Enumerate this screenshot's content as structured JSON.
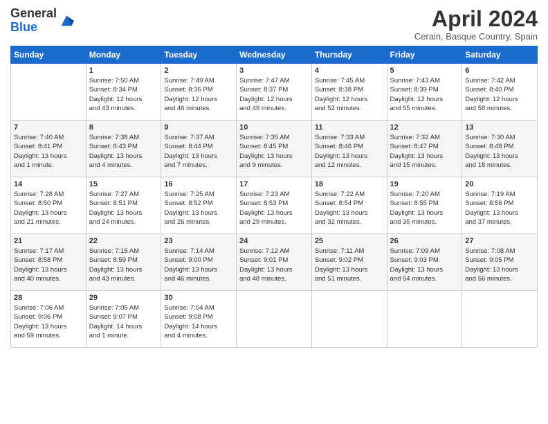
{
  "header": {
    "logo_general": "General",
    "logo_blue": "Blue",
    "title": "April 2024",
    "location": "Cerain, Basque Country, Spain"
  },
  "days_of_week": [
    "Sunday",
    "Monday",
    "Tuesday",
    "Wednesday",
    "Thursday",
    "Friday",
    "Saturday"
  ],
  "weeks": [
    [
      {
        "day": "",
        "info": ""
      },
      {
        "day": "1",
        "info": "Sunrise: 7:50 AM\nSunset: 8:34 PM\nDaylight: 12 hours\nand 43 minutes."
      },
      {
        "day": "2",
        "info": "Sunrise: 7:49 AM\nSunset: 8:36 PM\nDaylight: 12 hours\nand 46 minutes."
      },
      {
        "day": "3",
        "info": "Sunrise: 7:47 AM\nSunset: 8:37 PM\nDaylight: 12 hours\nand 49 minutes."
      },
      {
        "day": "4",
        "info": "Sunrise: 7:45 AM\nSunset: 8:38 PM\nDaylight: 12 hours\nand 52 minutes."
      },
      {
        "day": "5",
        "info": "Sunrise: 7:43 AM\nSunset: 8:39 PM\nDaylight: 12 hours\nand 55 minutes."
      },
      {
        "day": "6",
        "info": "Sunrise: 7:42 AM\nSunset: 8:40 PM\nDaylight: 12 hours\nand 58 minutes."
      }
    ],
    [
      {
        "day": "7",
        "info": "Sunrise: 7:40 AM\nSunset: 8:41 PM\nDaylight: 13 hours\nand 1 minute."
      },
      {
        "day": "8",
        "info": "Sunrise: 7:38 AM\nSunset: 8:43 PM\nDaylight: 13 hours\nand 4 minutes."
      },
      {
        "day": "9",
        "info": "Sunrise: 7:37 AM\nSunset: 8:44 PM\nDaylight: 13 hours\nand 7 minutes."
      },
      {
        "day": "10",
        "info": "Sunrise: 7:35 AM\nSunset: 8:45 PM\nDaylight: 13 hours\nand 9 minutes."
      },
      {
        "day": "11",
        "info": "Sunrise: 7:33 AM\nSunset: 8:46 PM\nDaylight: 13 hours\nand 12 minutes."
      },
      {
        "day": "12",
        "info": "Sunrise: 7:32 AM\nSunset: 8:47 PM\nDaylight: 13 hours\nand 15 minutes."
      },
      {
        "day": "13",
        "info": "Sunrise: 7:30 AM\nSunset: 8:48 PM\nDaylight: 13 hours\nand 18 minutes."
      }
    ],
    [
      {
        "day": "14",
        "info": "Sunrise: 7:28 AM\nSunset: 8:50 PM\nDaylight: 13 hours\nand 21 minutes."
      },
      {
        "day": "15",
        "info": "Sunrise: 7:27 AM\nSunset: 8:51 PM\nDaylight: 13 hours\nand 24 minutes."
      },
      {
        "day": "16",
        "info": "Sunrise: 7:25 AM\nSunset: 8:52 PM\nDaylight: 13 hours\nand 26 minutes."
      },
      {
        "day": "17",
        "info": "Sunrise: 7:23 AM\nSunset: 8:53 PM\nDaylight: 13 hours\nand 29 minutes."
      },
      {
        "day": "18",
        "info": "Sunrise: 7:22 AM\nSunset: 8:54 PM\nDaylight: 13 hours\nand 32 minutes."
      },
      {
        "day": "19",
        "info": "Sunrise: 7:20 AM\nSunset: 8:55 PM\nDaylight: 13 hours\nand 35 minutes."
      },
      {
        "day": "20",
        "info": "Sunrise: 7:19 AM\nSunset: 8:56 PM\nDaylight: 13 hours\nand 37 minutes."
      }
    ],
    [
      {
        "day": "21",
        "info": "Sunrise: 7:17 AM\nSunset: 8:58 PM\nDaylight: 13 hours\nand 40 minutes."
      },
      {
        "day": "22",
        "info": "Sunrise: 7:15 AM\nSunset: 8:59 PM\nDaylight: 13 hours\nand 43 minutes."
      },
      {
        "day": "23",
        "info": "Sunrise: 7:14 AM\nSunset: 9:00 PM\nDaylight: 13 hours\nand 46 minutes."
      },
      {
        "day": "24",
        "info": "Sunrise: 7:12 AM\nSunset: 9:01 PM\nDaylight: 13 hours\nand 48 minutes."
      },
      {
        "day": "25",
        "info": "Sunrise: 7:11 AM\nSunset: 9:02 PM\nDaylight: 13 hours\nand 51 minutes."
      },
      {
        "day": "26",
        "info": "Sunrise: 7:09 AM\nSunset: 9:03 PM\nDaylight: 13 hours\nand 54 minutes."
      },
      {
        "day": "27",
        "info": "Sunrise: 7:08 AM\nSunset: 9:05 PM\nDaylight: 13 hours\nand 56 minutes."
      }
    ],
    [
      {
        "day": "28",
        "info": "Sunrise: 7:06 AM\nSunset: 9:06 PM\nDaylight: 13 hours\nand 59 minutes."
      },
      {
        "day": "29",
        "info": "Sunrise: 7:05 AM\nSunset: 9:07 PM\nDaylight: 14 hours\nand 1 minute."
      },
      {
        "day": "30",
        "info": "Sunrise: 7:04 AM\nSunset: 9:08 PM\nDaylight: 14 hours\nand 4 minutes."
      },
      {
        "day": "",
        "info": ""
      },
      {
        "day": "",
        "info": ""
      },
      {
        "day": "",
        "info": ""
      },
      {
        "day": "",
        "info": ""
      }
    ]
  ]
}
